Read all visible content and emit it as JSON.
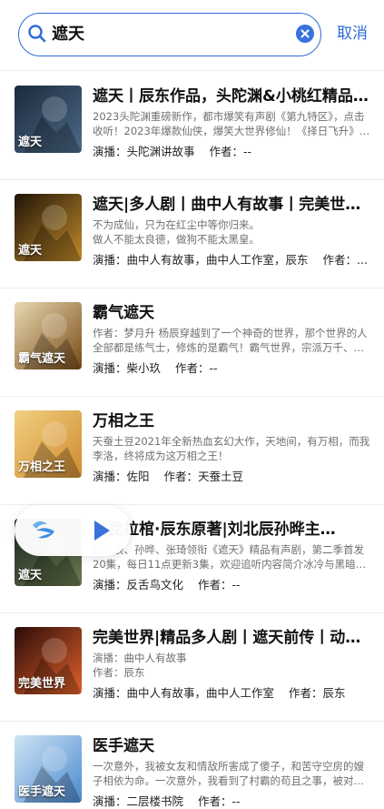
{
  "search": {
    "query": "遮天",
    "cancel_label": "取消"
  },
  "results": [
    {
      "title": "遮天丨辰东作品，头陀渊&小桃红精品…",
      "desc_lines": [
        "2023头陀渊重磅新作，都市爆笑有声剧《第九特区》，点击",
        "收听！2023年爆款仙侠，爆笑大世界修仙！《择日飞升》…"
      ],
      "meta": [
        "演播：头陀渊讲故事",
        "作者：--"
      ],
      "cover_text": "遮天",
      "cover_colors": [
        "#1c2a3c",
        "#4c6a88"
      ]
    },
    {
      "title": "遮天|多人剧丨曲中人有故事丨完美世…",
      "desc_lines": [
        "不为成仙，只为在红尘中等你归来。",
        "做人不能太良德，做狗不能太黑皇。"
      ],
      "meta": [
        "演播：曲中人有故事，曲中人工作室，辰东",
        "作者：..."
      ],
      "cover_text": "遮天",
      "cover_colors": [
        "#201408",
        "#c08a2a"
      ]
    },
    {
      "title": "霸气遮天",
      "desc_lines": [
        "作者：梦月升 杨辰穿越到了一个神奇的世界，那个世界的人",
        "全部都是练气士，修炼的是霸气！霸气世界，宗派万千、…"
      ],
      "meta": [
        "演播：柴小玖",
        "作者：--"
      ],
      "cover_text": "霸气遮天",
      "cover_colors": [
        "#e8d9b0",
        "#7a4a18"
      ]
    },
    {
      "title": "万相之王",
      "desc_lines": [
        "天蚕土豆2021年全新热血玄幻大作，天地间，有万相，而我",
        "李洛，终将成为这万相之王！"
      ],
      "meta": [
        "演播：佐阳",
        "作者：天蚕土豆"
      ],
      "cover_text": "万相之王",
      "cover_colors": [
        "#f0d080",
        "#d08a30"
      ]
    },
    {
      "title": "九龙拉棺·辰东原著|刘北辰孙晔主…",
      "desc_lines": [
        "刘北辰、孙晔、张琦领衔《遮天》精品有声剧，第二季首发",
        "20集，每日11点更新3集，欢迎追听内容简介冰冷与黑暗并…"
      ],
      "meta": [
        "演播：反舌鸟文化",
        "作者：--"
      ],
      "cover_text": "遮天",
      "cover_colors": [
        "#1e2820",
        "#6a7a50"
      ]
    },
    {
      "title": "完美世界|精品多人剧丨遮天前传丨动…",
      "desc_lines": [
        "演播：曲中人有故事",
        "作者：辰东"
      ],
      "meta": [
        "演播：曲中人有故事，曲中人工作室",
        "作者：辰东"
      ],
      "cover_text": "完美世界",
      "cover_colors": [
        "#2a0c08",
        "#e0602a"
      ]
    },
    {
      "title": "医手遮天",
      "desc_lines": [
        "一次意外，我被女友和情敌所害成了傻子，和苦守空房的嫂",
        "子相依为命。一次意外，我看到了村霸的苟且之事，被对…"
      ],
      "meta": [
        "演播：二层楼书院",
        "作者：--"
      ],
      "cover_text": "医手遮天",
      "cover_colors": [
        "#cfe4f4",
        "#4a8ad0"
      ]
    }
  ],
  "player": {
    "accent": "#3a72dd"
  },
  "colors": {
    "accent": "#2f6bd8",
    "divider": "#eeeeee"
  }
}
